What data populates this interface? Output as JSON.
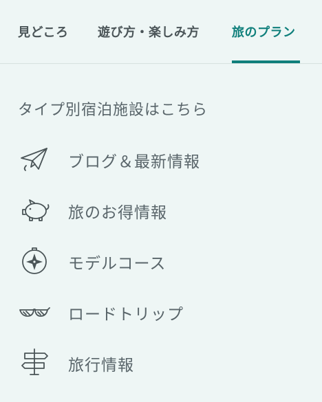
{
  "tabs": [
    {
      "label": "見どころ"
    },
    {
      "label": "遊び方・楽しみ方"
    },
    {
      "label": "旅のプラン",
      "active": true
    }
  ],
  "colors": {
    "accent": "#0f7f7b",
    "background": "#eef6f5",
    "text": "#59656a"
  },
  "section": {
    "title": "タイプ別宿泊施設はこちら"
  },
  "menu": [
    {
      "label": "ブログ＆最新情報",
      "icon": "paper-plane-icon"
    },
    {
      "label": "旅のお得情報",
      "icon": "piggy-bank-icon"
    },
    {
      "label": "モデルコース",
      "icon": "compass-icon"
    },
    {
      "label": "ロードトリップ",
      "icon": "sunglasses-icon"
    },
    {
      "label": "旅行情報",
      "icon": "signpost-icon"
    }
  ]
}
